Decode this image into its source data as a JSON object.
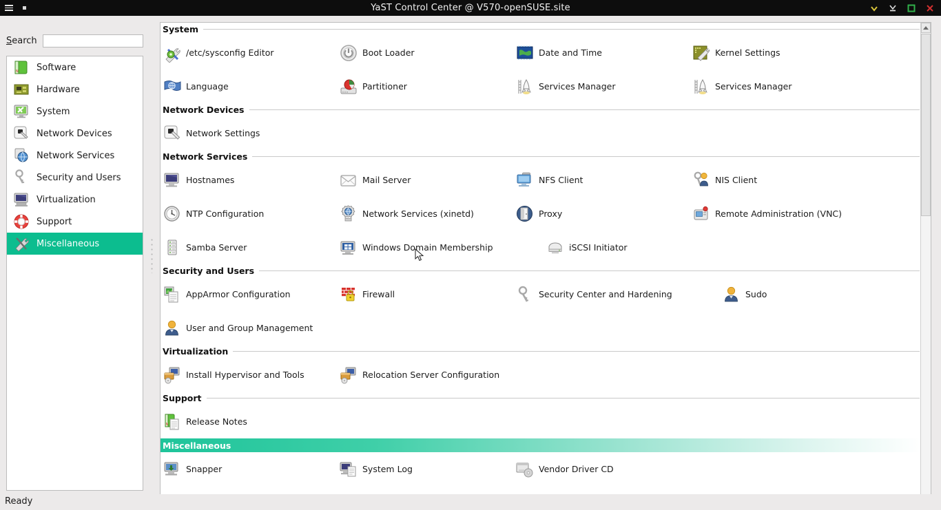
{
  "window": {
    "title": "YaST Control Center @ V570-openSUSE.site",
    "controls": [
      {
        "name": "minimize-button",
        "glyph": "chevron-down-icon",
        "color": "#d8c33a"
      },
      {
        "name": "shade-button",
        "glyph": "collapse-icon",
        "color": "#dcdcdc"
      },
      {
        "name": "maximize-button",
        "glyph": "square-icon",
        "color": "#31b14a"
      },
      {
        "name": "close-button",
        "glyph": "x-icon",
        "color": "#cf3030"
      }
    ],
    "menu_icon": "hamburger-icon",
    "restore_icon": "restore-window-icon"
  },
  "search": {
    "label_prefix": "S",
    "label_rest": "earch",
    "value": "",
    "placeholder": ""
  },
  "sidebar": {
    "items": [
      {
        "label": "Software",
        "icon": "software-package-icon",
        "selected": false
      },
      {
        "label": "Hardware",
        "icon": "circuit-board-icon",
        "selected": false
      },
      {
        "label": "System",
        "icon": "monitor-wrench-icon",
        "selected": false
      },
      {
        "label": "Network Devices",
        "icon": "network-plug-icon",
        "selected": false
      },
      {
        "label": "Network Services",
        "icon": "network-globe-icon",
        "selected": false
      },
      {
        "label": "Security and Users",
        "icon": "keys-icon",
        "selected": false
      },
      {
        "label": "Virtualization",
        "icon": "computer-icon",
        "selected": false
      },
      {
        "label": "Support",
        "icon": "lifebuoy-icon",
        "selected": false
      },
      {
        "label": "Miscellaneous",
        "icon": "tools-icon",
        "selected": true
      }
    ]
  },
  "sections": [
    {
      "title": "System",
      "highlighted": false,
      "modules": [
        {
          "label": "/etc/sysconfig Editor",
          "icon": "wrench-screwdriver-icon"
        },
        {
          "label": "Boot Loader",
          "icon": "power-button-icon"
        },
        {
          "label": "Date and Time",
          "icon": "world-map-icon"
        },
        {
          "label": "Kernel Settings",
          "icon": "kernel-wrench-icon"
        },
        {
          "label": "Language",
          "icon": "flag-globe-icon"
        },
        {
          "label": "Partitioner",
          "icon": "disk-pie-icon"
        },
        {
          "label": "Services Manager",
          "icon": "rocket-launch-icon"
        },
        {
          "label": "Services Manager",
          "icon": "rocket-launch-icon"
        }
      ]
    },
    {
      "title": "Network Devices",
      "highlighted": false,
      "modules": [
        {
          "label": "Network Settings",
          "icon": "network-plug-icon"
        }
      ]
    },
    {
      "title": "Network Services",
      "highlighted": false,
      "modules": [
        {
          "label": "Hostnames",
          "icon": "monitor-icon"
        },
        {
          "label": "Mail Server",
          "icon": "envelope-icon"
        },
        {
          "label": "NFS Client",
          "icon": "folder-monitor-icon"
        },
        {
          "label": "NIS Client",
          "icon": "key-people-icon"
        },
        {
          "label": "NTP Configuration",
          "icon": "clock-icon"
        },
        {
          "label": "Network Services (xinetd)",
          "icon": "gear-globe-icon"
        },
        {
          "label": "Proxy",
          "icon": "door-globe-icon"
        },
        {
          "label": "Remote Administration (VNC)",
          "icon": "remote-screen-icon"
        },
        {
          "label": "Samba Server",
          "icon": "server-rack-icon"
        },
        {
          "label": "Windows Domain Membership",
          "icon": "windows-monitor-icon"
        },
        {
          "label": "iSCSI Initiator",
          "icon": "disk-drive-icon"
        }
      ]
    },
    {
      "title": "Security and Users",
      "highlighted": false,
      "modules": [
        {
          "label": "AppArmor Configuration",
          "icon": "shield-document-icon"
        },
        {
          "label": "Firewall",
          "icon": "brick-wall-lock-icon"
        },
        {
          "label": "Security Center and Hardening",
          "icon": "keys-icon"
        },
        {
          "label": "Sudo",
          "icon": "user-icon"
        },
        {
          "label": "User and Group Management",
          "icon": "user-icon"
        }
      ]
    },
    {
      "title": "Virtualization",
      "highlighted": false,
      "modules": [
        {
          "label": "Install Hypervisor and Tools",
          "icon": "box-monitor-icon"
        },
        {
          "label": "Relocation Server Configuration",
          "icon": "box-monitor-icon"
        }
      ]
    },
    {
      "title": "Support",
      "highlighted": false,
      "modules": [
        {
          "label": "Release Notes",
          "icon": "book-document-icon"
        }
      ]
    },
    {
      "title": "Miscellaneous",
      "highlighted": true,
      "modules": [
        {
          "label": "Snapper",
          "icon": "monitor-arrow-icon"
        },
        {
          "label": "System Log",
          "icon": "monitor-log-icon"
        },
        {
          "label": "Vendor Driver CD",
          "icon": "cd-drive-icon"
        }
      ]
    }
  ],
  "statusbar": {
    "text": "Ready"
  },
  "colors": {
    "selection": "#0cbd8f",
    "titlebar_bg": "#0d0d0d",
    "window_bg": "#eceaea",
    "panel_bg": "#ffffff"
  }
}
